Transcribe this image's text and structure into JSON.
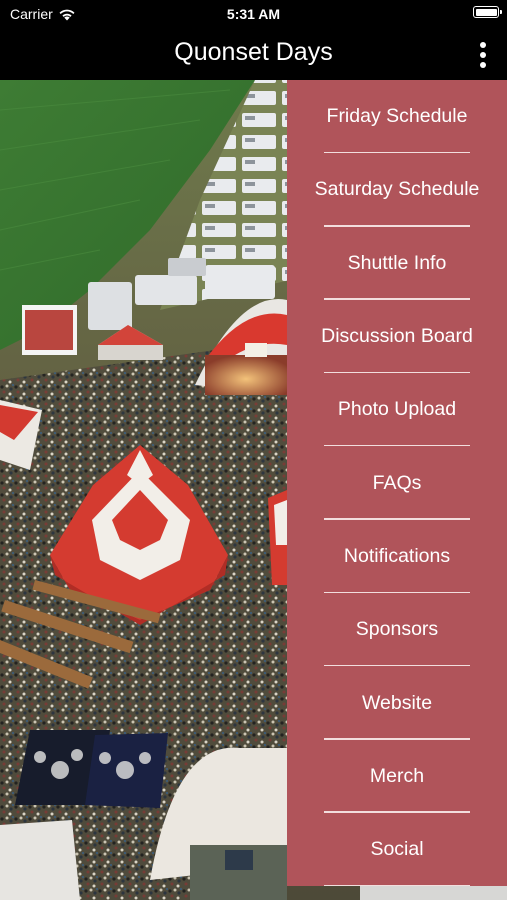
{
  "status_bar": {
    "carrier": "Carrier",
    "time": "5:31 AM",
    "icons": [
      "wifi-icon",
      "battery-icon"
    ]
  },
  "nav": {
    "title": "Quonset Days",
    "more_icon": "more-vertical-icon"
  },
  "drawer": {
    "background_color": "#b0545a",
    "items": [
      {
        "label": "Friday Schedule"
      },
      {
        "label": "Saturday Schedule"
      },
      {
        "label": "Shuttle Info"
      },
      {
        "label": "Discussion Board"
      },
      {
        "label": "Photo Upload"
      },
      {
        "label": "FAQs"
      },
      {
        "label": "Notifications"
      },
      {
        "label": "Sponsors"
      },
      {
        "label": "Website"
      },
      {
        "label": "Merch"
      },
      {
        "label": "Social"
      }
    ]
  }
}
